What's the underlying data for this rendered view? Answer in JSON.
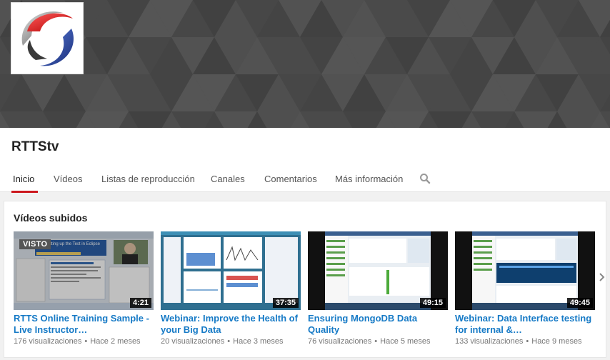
{
  "channel": {
    "name": "RTTStv"
  },
  "tabs": [
    {
      "label": "Inicio"
    },
    {
      "label": "Vídeos"
    },
    {
      "label": "Listas de reproducción"
    },
    {
      "label": "Canales"
    },
    {
      "label": "Comentarios"
    },
    {
      "label": "Más información"
    }
  ],
  "icons": {
    "search": "search-icon",
    "next": "chevron-right-icon",
    "avatar": "rtts-logo"
  },
  "colors": {
    "accent_red": "#cc181e",
    "link_blue": "#167ac6",
    "banner": "#4a4a4a"
  },
  "section": {
    "title": "Vídeos subidos"
  },
  "videos": [
    {
      "title": "RTTS Online Training Sample - Live Instructor…",
      "duration": "4:21",
      "views": "176 visualizaciones",
      "age": "Hace 2 meses",
      "watched_label": "VISTO",
      "thumb_caption": "Setting up the Test in Eclipse"
    },
    {
      "title": "Webinar: Improve the Health of your Big Data",
      "duration": "37:35",
      "views": "20 visualizaciones",
      "age": "Hace 3 meses"
    },
    {
      "title": "Ensuring MongoDB Data Quality",
      "duration": "49:15",
      "views": "76 visualizaciones",
      "age": "Hace 5 meses"
    },
    {
      "title": "Webinar: Data Interface testing for internal &…",
      "duration": "49:45",
      "views": "133 visualizaciones",
      "age": "Hace 9 meses"
    }
  ]
}
